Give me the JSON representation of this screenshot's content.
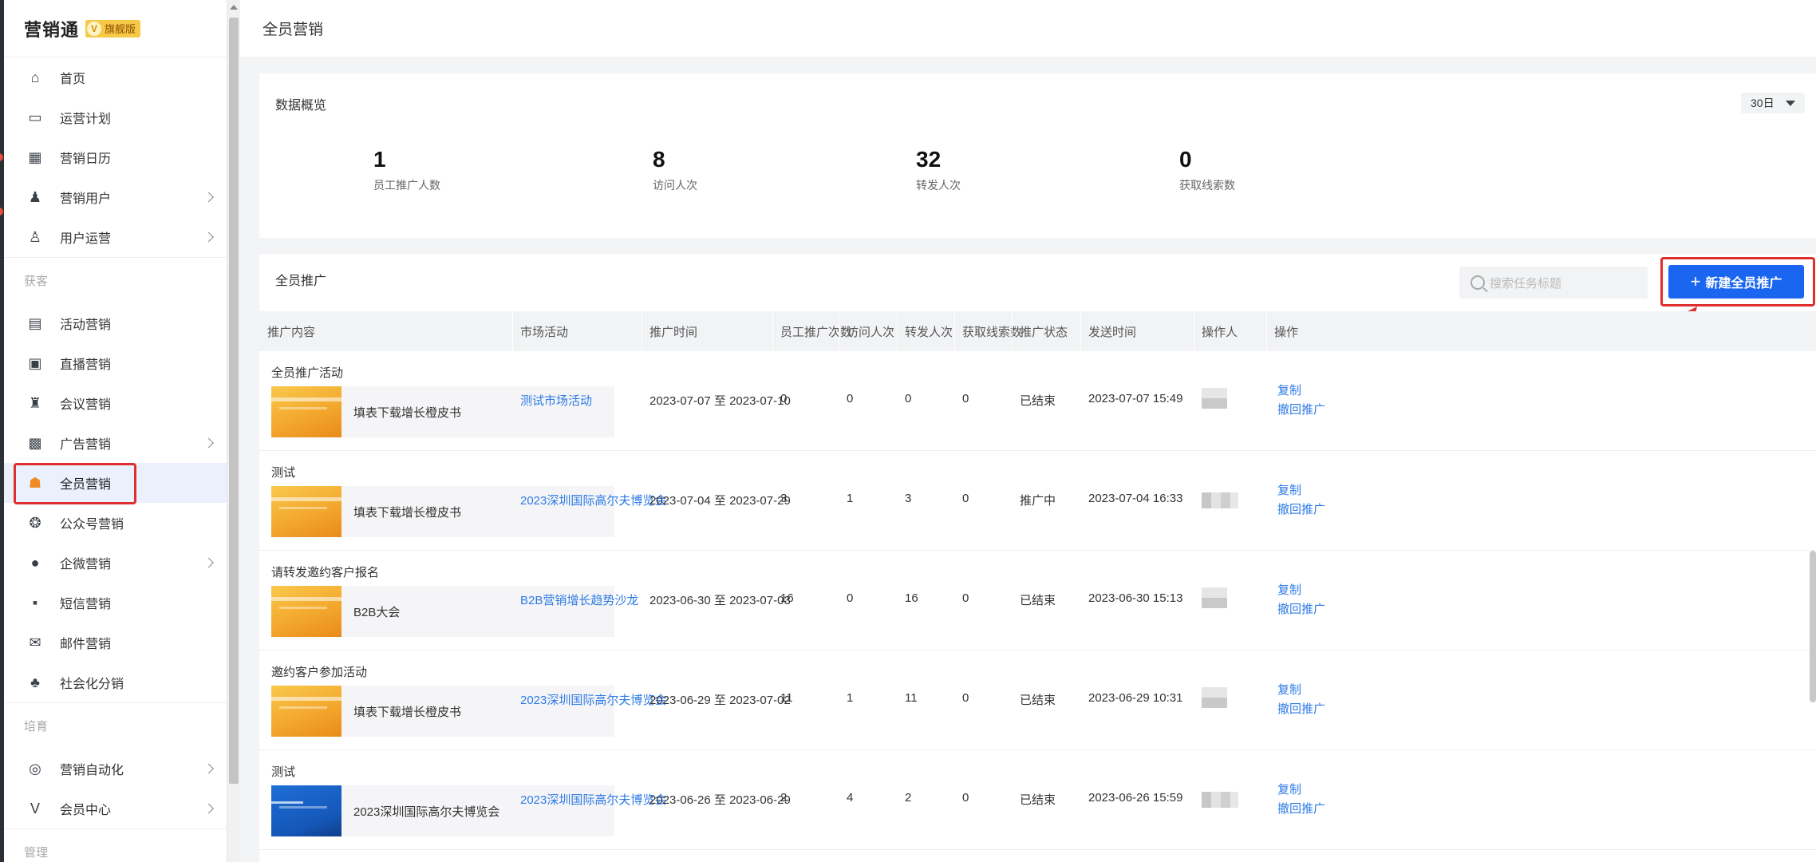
{
  "brand": {
    "name": "营销通",
    "badge": "旗舰版",
    "badge_letter": "V"
  },
  "sidebar": {
    "items_top": [
      {
        "label": "首页",
        "icon": "home-icon",
        "glyph": "⌂"
      },
      {
        "label": "运营计划",
        "icon": "plan-icon",
        "glyph": "▭"
      },
      {
        "label": "营销日历",
        "icon": "calendar-icon",
        "glyph": "▦"
      },
      {
        "label": "营销用户",
        "icon": "users-icon",
        "glyph": "♟"
      },
      {
        "label": "用户运营",
        "icon": "user-ops-icon",
        "glyph": "♙"
      }
    ],
    "section_acquire": "获客",
    "items_acquire": [
      {
        "label": "活动营销",
        "icon": "activity-icon",
        "glyph": "▤"
      },
      {
        "label": "直播营销",
        "icon": "live-icon",
        "glyph": "▣"
      },
      {
        "label": "会议营销",
        "icon": "meeting-icon",
        "glyph": "♜"
      },
      {
        "label": "广告营销",
        "icon": "ad-icon",
        "glyph": "▩"
      },
      {
        "label": "全员营销",
        "icon": "team-icon",
        "glyph": "☗"
      },
      {
        "label": "公众号营销",
        "icon": "wechat-icon",
        "glyph": "❂"
      },
      {
        "label": "企微营销",
        "icon": "wecom-icon",
        "glyph": "●"
      },
      {
        "label": "短信营销",
        "icon": "sms-icon",
        "glyph": "▪"
      },
      {
        "label": "邮件营销",
        "icon": "mail-icon",
        "glyph": "✉"
      },
      {
        "label": "社会化分销",
        "icon": "distribution-icon",
        "glyph": "♣"
      }
    ],
    "section_nurture": "培育",
    "items_nurture": [
      {
        "label": "营销自动化",
        "icon": "automation-icon",
        "glyph": "◎"
      },
      {
        "label": "会员中心",
        "icon": "vip-icon",
        "glyph": "V"
      }
    ],
    "section_manage": "管理"
  },
  "header": {
    "title": "全员营销"
  },
  "overview": {
    "title": "数据概览",
    "range": "30日",
    "stats": [
      {
        "value": "1",
        "label": "员工推广人数"
      },
      {
        "value": "8",
        "label": "访问人次"
      },
      {
        "value": "32",
        "label": "转发人次"
      },
      {
        "value": "0",
        "label": "获取线索数"
      }
    ]
  },
  "promo": {
    "title": "全员推广",
    "search_placeholder": "搜索任务标题",
    "new_button": "新建全员推广",
    "columns": [
      "推广内容",
      "市场活动",
      "推广时间",
      "员工推广次数",
      "访问人次",
      "转发人次",
      "获取线索数",
      "推广状态",
      "发送时间",
      "操作人",
      "操作"
    ],
    "op_copy": "复制",
    "op_withdraw": "撤回推广",
    "rows": [
      {
        "title": "全员推广活动",
        "content": "填表下载增长橙皮书",
        "thumb": "orange",
        "activity": "测试市场活动",
        "period": "2023-07-07 至 2023-07-10",
        "employee_count": "0",
        "visits": "0",
        "forwards": "0",
        "leads": "0",
        "status": "已结束",
        "sent": "2023-07-07 15:49"
      },
      {
        "title": "测试",
        "content": "填表下载增长橙皮书",
        "thumb": "orange",
        "activity": "2023深圳国际高尔夫博览会",
        "period": "2023-07-04 至 2023-07-29",
        "employee_count": "3",
        "visits": "1",
        "forwards": "3",
        "leads": "0",
        "status": "推广中",
        "sent": "2023-07-04 16:33"
      },
      {
        "title": "请转发邀约客户报名",
        "content": "B2B大会",
        "thumb": "orange",
        "activity": "B2B营销增长趋势沙龙",
        "period": "2023-06-30 至 2023-07-03",
        "employee_count": "16",
        "visits": "0",
        "forwards": "16",
        "leads": "0",
        "status": "已结束",
        "sent": "2023-06-30 15:13"
      },
      {
        "title": "邀约客户参加活动",
        "content": "填表下载增长橙皮书",
        "thumb": "orange",
        "activity": "2023深圳国际高尔夫博览会",
        "period": "2023-06-29 至 2023-07-02",
        "employee_count": "11",
        "visits": "1",
        "forwards": "11",
        "leads": "0",
        "status": "已结束",
        "sent": "2023-06-29 10:31"
      },
      {
        "title": "测试",
        "content": "2023深圳国际高尔夫博览会",
        "thumb": "blue",
        "activity": "2023深圳国际高尔夫博览会",
        "period": "2023-06-26 至 2023-06-29",
        "employee_count": "2",
        "visits": "4",
        "forwards": "2",
        "leads": "0",
        "status": "已结束",
        "sent": "2023-06-26 15:59"
      }
    ]
  },
  "colors": {
    "primary": "#1a66f0",
    "link": "#2f7be6",
    "highlight": "#e02d2d",
    "active_bg": "#eaf1fd"
  }
}
